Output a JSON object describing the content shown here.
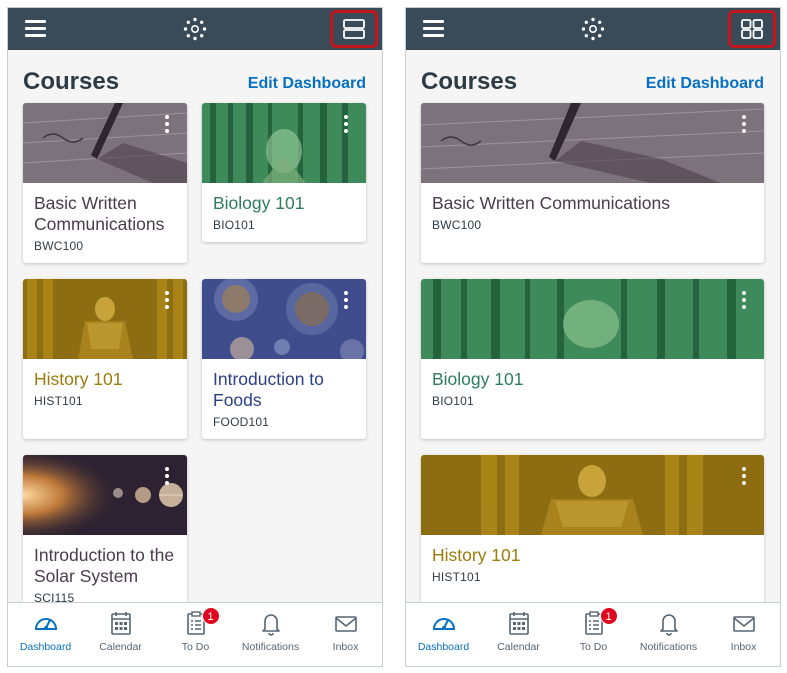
{
  "screens": [
    {
      "heading": "Courses",
      "edit_link": "Edit Dashboard",
      "layout_toggle_icon": "list-view-icon",
      "cards": [
        {
          "title": "Basic Written Communications",
          "code": "BWC100",
          "color": "#4a3b4c"
        },
        {
          "title": "Biology 101",
          "code": "BIO101",
          "color": "#2e7d5b"
        },
        {
          "title": "History 101",
          "code": "HIST101",
          "color": "#9c7a0c"
        },
        {
          "title": "Introduction to Foods",
          "code": "FOOD101",
          "color": "#2a3f8a"
        },
        {
          "title": "Introduction to the Solar System",
          "code": "SCI115",
          "color": "#4a3b4c"
        }
      ]
    },
    {
      "heading": "Courses",
      "edit_link": "Edit Dashboard",
      "layout_toggle_icon": "grid-view-icon",
      "cards": [
        {
          "title": "Basic Written Communications",
          "code": "BWC100",
          "color": "#4a3b4c"
        },
        {
          "title": "Biology 101",
          "code": "BIO101",
          "color": "#2e7d5b"
        },
        {
          "title": "History 101",
          "code": "HIST101",
          "color": "#9c7a0c"
        }
      ]
    }
  ],
  "tabbar": {
    "dashboard": "Dashboard",
    "calendar": "Calendar",
    "todo": "To Do",
    "todo_badge": "1",
    "notifications": "Notifications",
    "inbox": "Inbox"
  },
  "colors": {
    "topbar": "#394b58",
    "link": "#0770c3",
    "highlight": "#c4161c",
    "badge": "#e0061f"
  }
}
